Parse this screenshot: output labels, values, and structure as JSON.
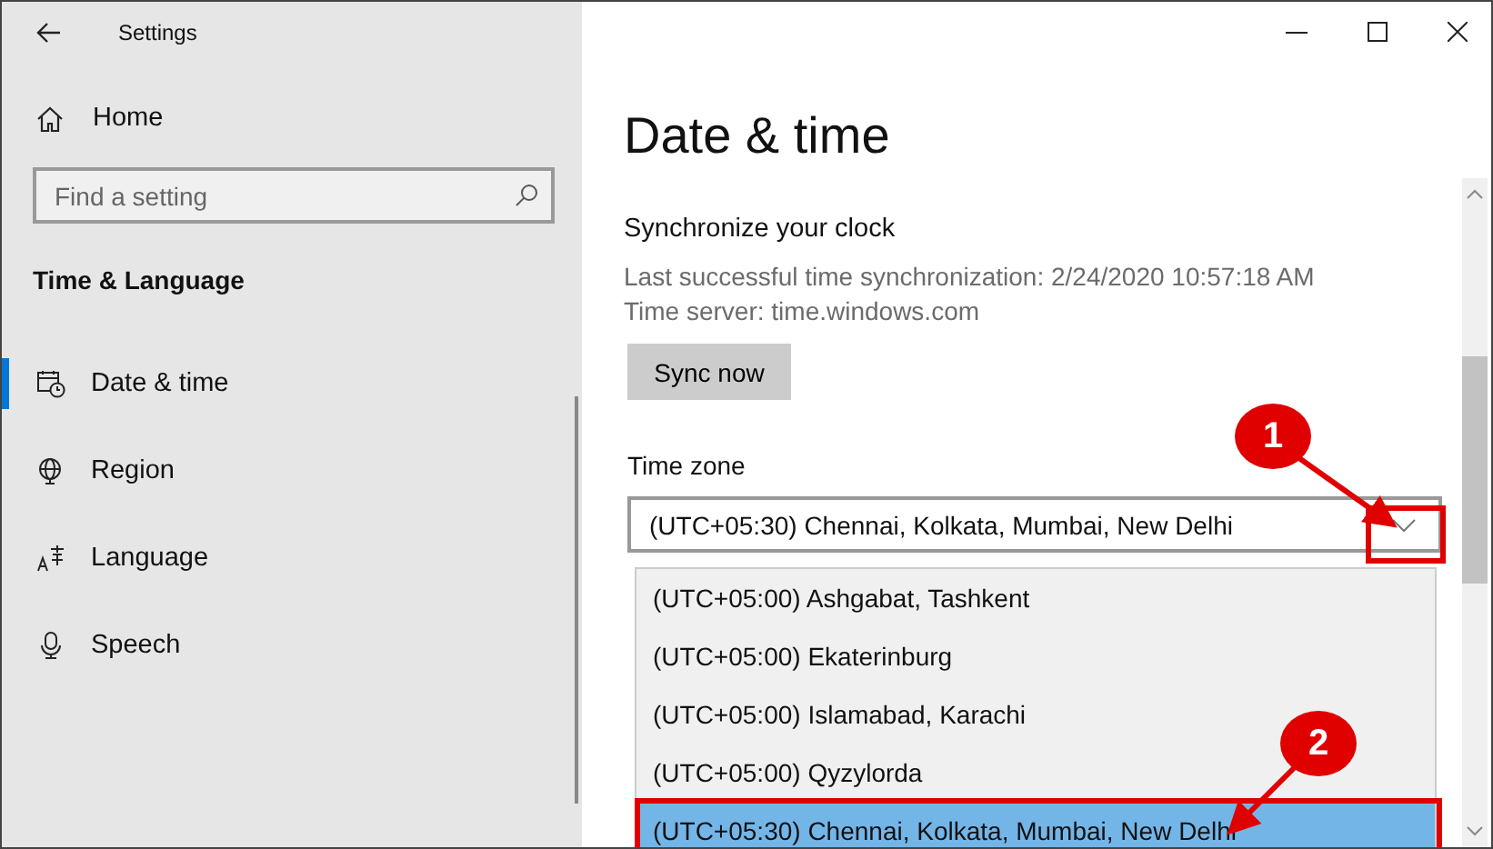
{
  "window": {
    "title": "Settings"
  },
  "sidebar": {
    "home": "Home",
    "search": {
      "placeholder": "Find a setting"
    },
    "section": "Time & Language",
    "items": [
      {
        "label": "Date & time",
        "selected": true
      },
      {
        "label": "Region",
        "selected": false
      },
      {
        "label": "Language",
        "selected": false
      },
      {
        "label": "Speech",
        "selected": false
      }
    ]
  },
  "page": {
    "title": "Date & time",
    "sync": {
      "heading": "Synchronize your clock",
      "last_sync": "Last successful time synchronization: 2/24/2020 10:57:18 AM",
      "server": "Time server: time.windows.com",
      "button": "Sync now"
    },
    "time_zone": {
      "label": "Time zone",
      "value": "(UTC+05:30) Chennai, Kolkata, Mumbai, New Delhi",
      "expanded": true,
      "options": [
        {
          "label": "(UTC+05:00) Ashgabat, Tashkent",
          "selected": false
        },
        {
          "label": "(UTC+05:00) Ekaterinburg",
          "selected": false
        },
        {
          "label": "(UTC+05:00) Islamabad, Karachi",
          "selected": false
        },
        {
          "label": "(UTC+05:00) Qyzylorda",
          "selected": false
        },
        {
          "label": "(UTC+05:30) Chennai, Kolkata, Mumbai, New Delhi",
          "selected": true
        }
      ]
    }
  },
  "annotations": [
    {
      "label": "1"
    },
    {
      "label": "2"
    }
  ]
}
